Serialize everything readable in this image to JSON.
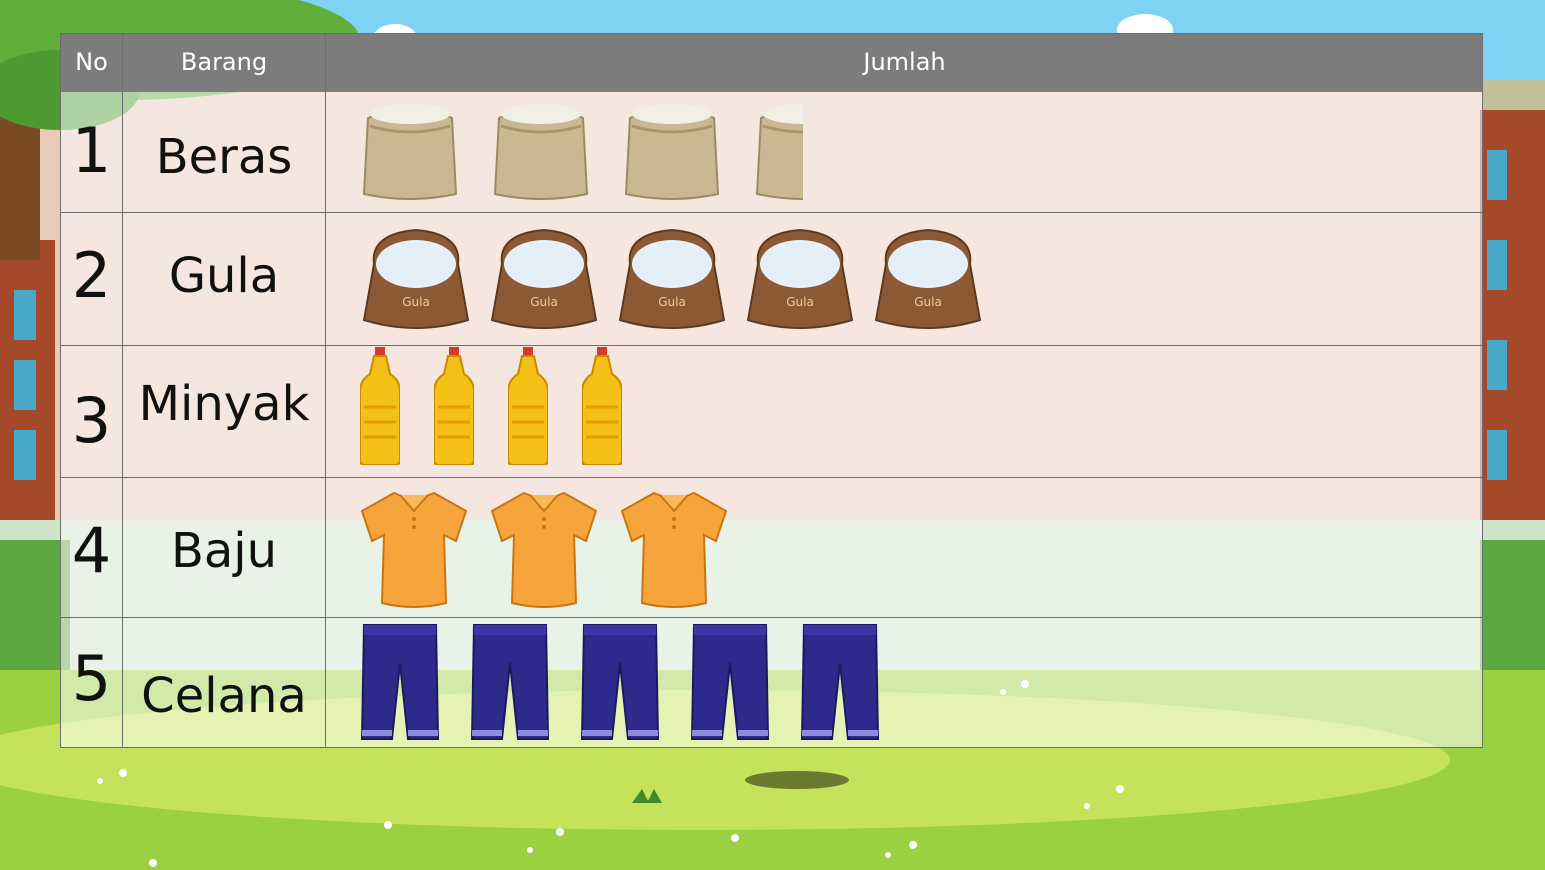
{
  "table": {
    "headers": {
      "no": "No",
      "item": "Barang",
      "amount": "Jumlah"
    },
    "rows": [
      {
        "no": "1",
        "name": "Beras",
        "count": 3.5,
        "icon": "rice-sack-icon"
      },
      {
        "no": "2",
        "name": "Gula",
        "count": 5,
        "icon": "sugar-sack-icon",
        "sack_label": "Gula"
      },
      {
        "no": "3",
        "name": "Minyak",
        "count": 4,
        "icon": "oil-bottle-icon"
      },
      {
        "no": "4",
        "name": "Baju",
        "count": 3,
        "icon": "shirt-icon"
      },
      {
        "no": "5",
        "name": "Celana",
        "count": 5,
        "icon": "pants-icon"
      }
    ]
  },
  "colors": {
    "sky": "#7fd3f2",
    "grass": "#9bd040",
    "header": "#7c7c7c",
    "shirt": "#f7a43c",
    "pants": "#2e2a8c",
    "oil": "#f5c016",
    "sack": "#c9b892"
  }
}
